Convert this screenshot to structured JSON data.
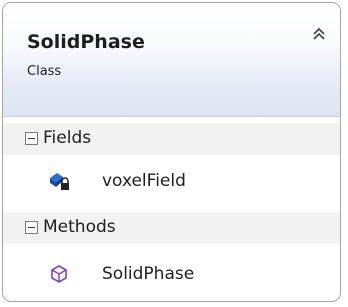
{
  "class_box": {
    "name": "SolidPhase",
    "stereotype": "Class",
    "collapse_icon": "double-chevron-up-icon",
    "sections": [
      {
        "label": "Fields",
        "toggle_icon": "minus-box-icon",
        "members": [
          {
            "name": "voxelField",
            "icon": "private-field-icon"
          }
        ]
      },
      {
        "label": "Methods",
        "toggle_icon": "minus-box-icon",
        "members": [
          {
            "name": "SolidPhase",
            "icon": "method-icon"
          }
        ]
      }
    ]
  }
}
